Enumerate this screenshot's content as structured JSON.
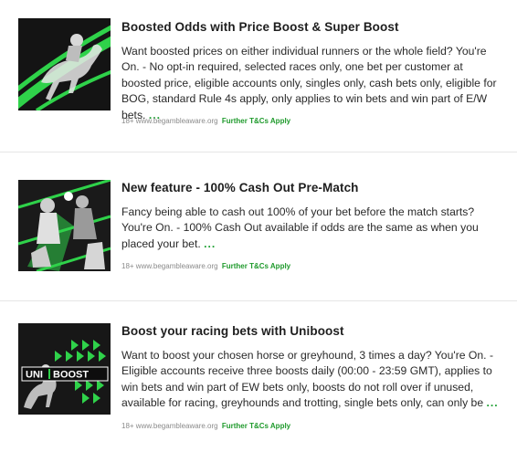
{
  "colors": {
    "accent_green": "#169c2c",
    "image_green": "#2fd24a",
    "dark_bg": "#111111",
    "divider": "#e6e6e6"
  },
  "promotions": [
    {
      "title": "Boosted Odds with Price Boost & Super Boost",
      "description": "Want boosted prices on either individual runners or the whole field? You're On. - No opt-in required, selected races only, one bet per customer at boosted price, eligible accounts only, singles only, cash bets only, eligible for BOG, standard Rule 4s apply, only applies to win bets and win part of E/W bets.",
      "more": "...",
      "gamble_aware": "18+ www.begambleaware.org",
      "terms_link": "Further T&Cs Apply",
      "image_icon": "racehorse-jockey-image"
    },
    {
      "title": "New feature - 100% Cash Out Pre-Match",
      "description": "Fancy being able to cash out 100% of your bet before the match starts? You're On. - 100% Cash Out available if odds are the same as when you placed your bet.",
      "more": "...",
      "gamble_aware": "18+ www.begambleaware.org",
      "terms_link": "Further T&Cs Apply",
      "image_icon": "sports-players-image"
    },
    {
      "title": "Boost your racing bets with Uniboost",
      "description": "Want to boost your chosen horse or greyhound, 3 times a day? You're On. - Eligible accounts receive three boosts daily (00:00 - 23:59 GMT), applies to win bets and win part of EW bets only, boosts do not roll over if unused, available for racing, greyhounds and trotting, single bets only, can only be",
      "more": "...",
      "gamble_aware": "18+ www.begambleaware.org",
      "terms_link": "Further T&Cs Apply",
      "image_icon": "uniboost-image",
      "image_text_left": "UNI",
      "image_text_right": "BOOST"
    }
  ]
}
